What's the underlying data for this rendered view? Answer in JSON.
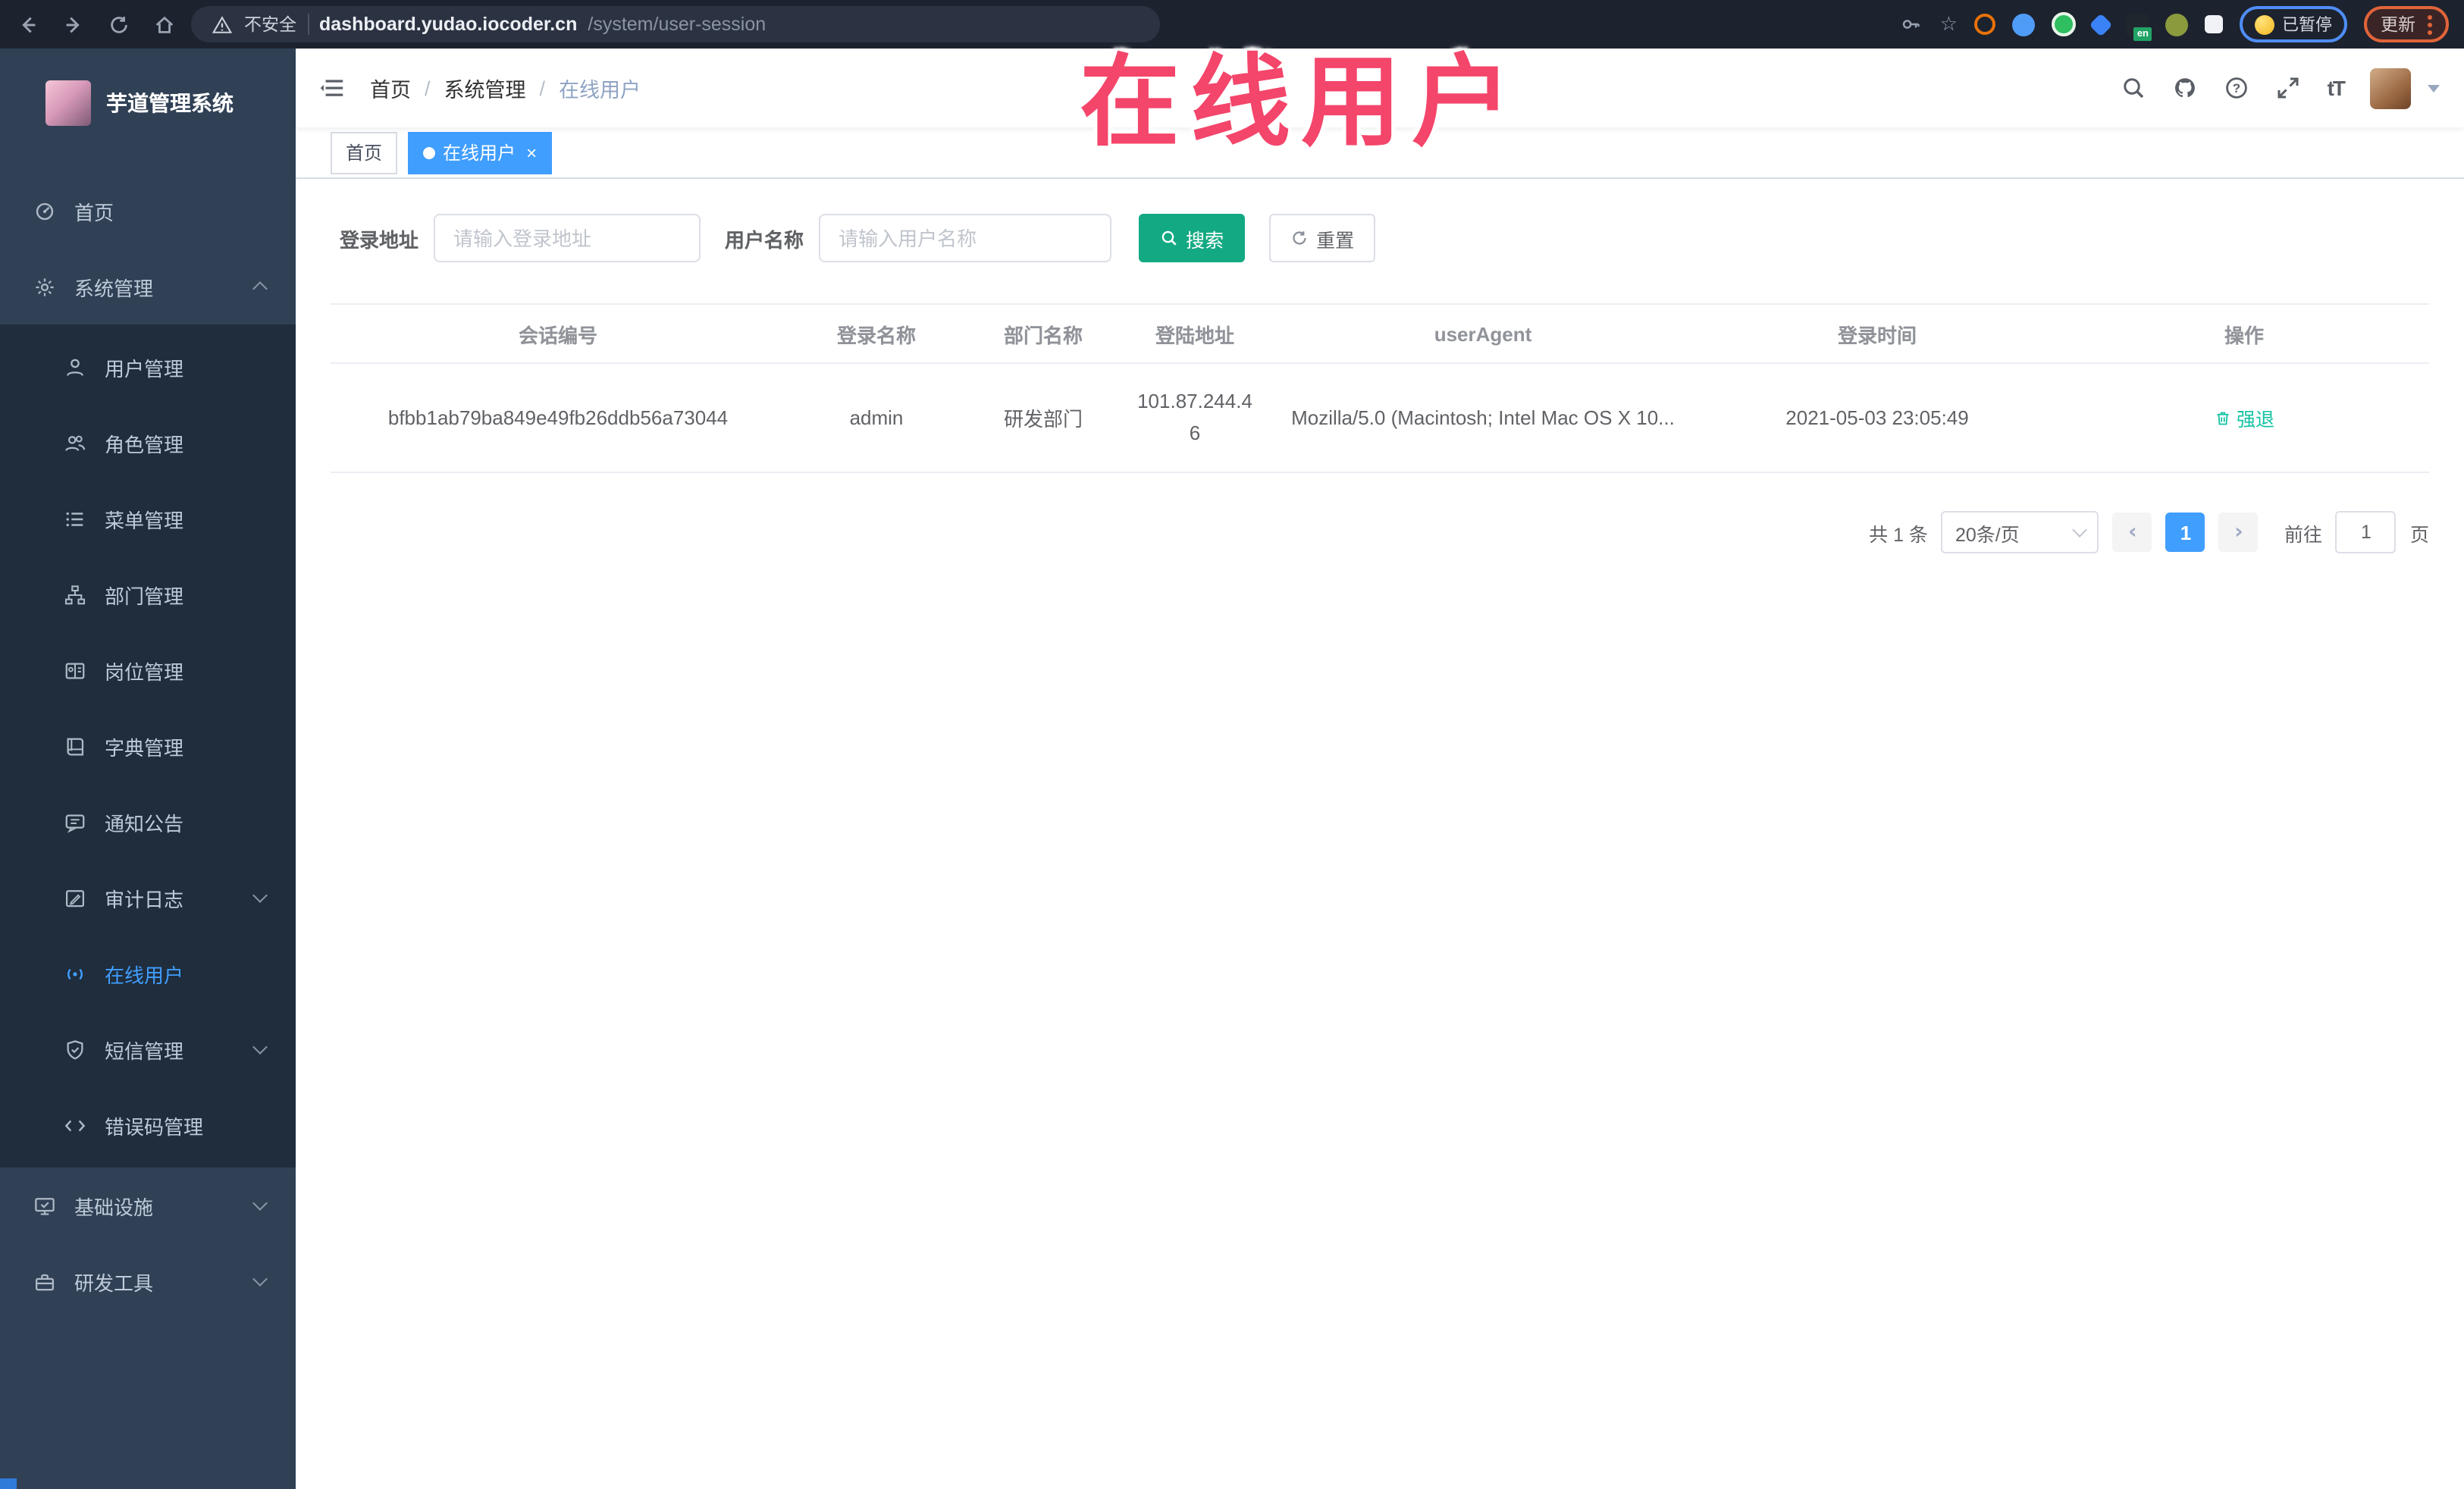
{
  "colors": {
    "accent": "#409EFF",
    "sidebar_bg": "#304156",
    "submenu_bg": "#1f2d3d",
    "search_button": "#13A983",
    "action_green": "#13C2A3",
    "overlay_red": "#F4456A"
  },
  "browser": {
    "security_label": "不安全",
    "url_host": "dashboard.yudao.iocoder.cn",
    "url_path": "/system/user-session",
    "star_glyph": "☆",
    "extension_badge": "en",
    "paused_label": "已暂停",
    "update_label": "更新"
  },
  "overlay_title": "在线用户",
  "sidebar": {
    "brand": "芋道管理系统",
    "home": "首页",
    "system": "系统管理",
    "children": [
      "用户管理",
      "角色管理",
      "菜单管理",
      "部门管理",
      "岗位管理",
      "字典管理",
      "通知公告",
      "审计日志",
      "在线用户",
      "短信管理",
      "错误码管理"
    ],
    "infra": "基础设施",
    "devtools": "研发工具"
  },
  "header": {
    "breadcrumb": [
      "首页",
      "系统管理",
      "在线用户"
    ],
    "breadcrumb_separator": "/",
    "font_icon": "tT"
  },
  "tabs": {
    "home": "首页",
    "active": "在线用户",
    "close_glyph": "×"
  },
  "search": {
    "addr_label": "登录地址",
    "addr_placeholder": "请输入登录地址",
    "name_label": "用户名称",
    "name_placeholder": "请输入用户名称",
    "search_label": "搜索",
    "reset_label": "重置"
  },
  "table": {
    "headers": [
      "会话编号",
      "登录名称",
      "部门名称",
      "登陆地址",
      "userAgent",
      "登录时间",
      "操作"
    ],
    "rows": [
      {
        "session_id": "bfbb1ab79ba849e49fb26ddb56a73044",
        "username": "admin",
        "dept": "研发部门",
        "ip": "101.87.244.46",
        "user_agent": "Mozilla/5.0 (Macintosh; Intel Mac OS X 10...",
        "login_time": "2021-05-03 23:05:49",
        "action": "强退"
      }
    ]
  },
  "pagination": {
    "total": "共 1 条",
    "page_size": "20条/页",
    "prev_glyph": "‹",
    "next_glyph": "›",
    "current": "1",
    "goto": "前往",
    "goto_value": "1",
    "unit": "页"
  }
}
